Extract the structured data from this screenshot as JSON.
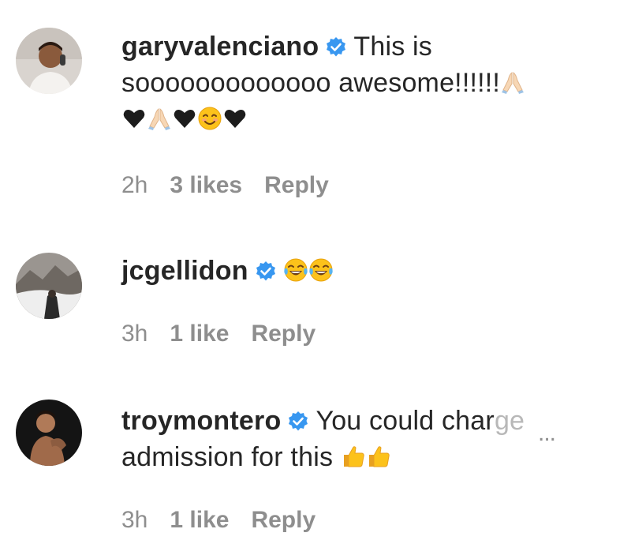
{
  "comments": [
    {
      "username": "garyvalenciano",
      "verified": true,
      "text_line1": "This is",
      "text_line2": "sooooooooooooo awesome!!!!!!",
      "emojis_line2": [
        "folded-hands"
      ],
      "emojis_line3": [
        "black-heart",
        "folded-hands",
        "black-heart",
        "smiling-face",
        "black-heart"
      ],
      "time": "2h",
      "likes": "3 likes",
      "reply": "Reply"
    },
    {
      "username": "jcgellidon",
      "verified": true,
      "text_line1": "",
      "emojis_line1": [
        "tears-of-joy",
        "tears-of-joy"
      ],
      "time": "3h",
      "likes": "1 like",
      "reply": "Reply"
    },
    {
      "username": "troymontero",
      "verified": true,
      "text_line1": "You could char",
      "text_line1_faded": "ge",
      "more": "...",
      "text_line2": "admission for this",
      "emojis_line2": [
        "thumbs-up",
        "thumbs-up"
      ],
      "time": "3h",
      "likes": "1 like",
      "reply": "Reply"
    }
  ],
  "colors": {
    "text": "#262626",
    "meta": "#8e8e8e",
    "verified": "#3897f0"
  }
}
